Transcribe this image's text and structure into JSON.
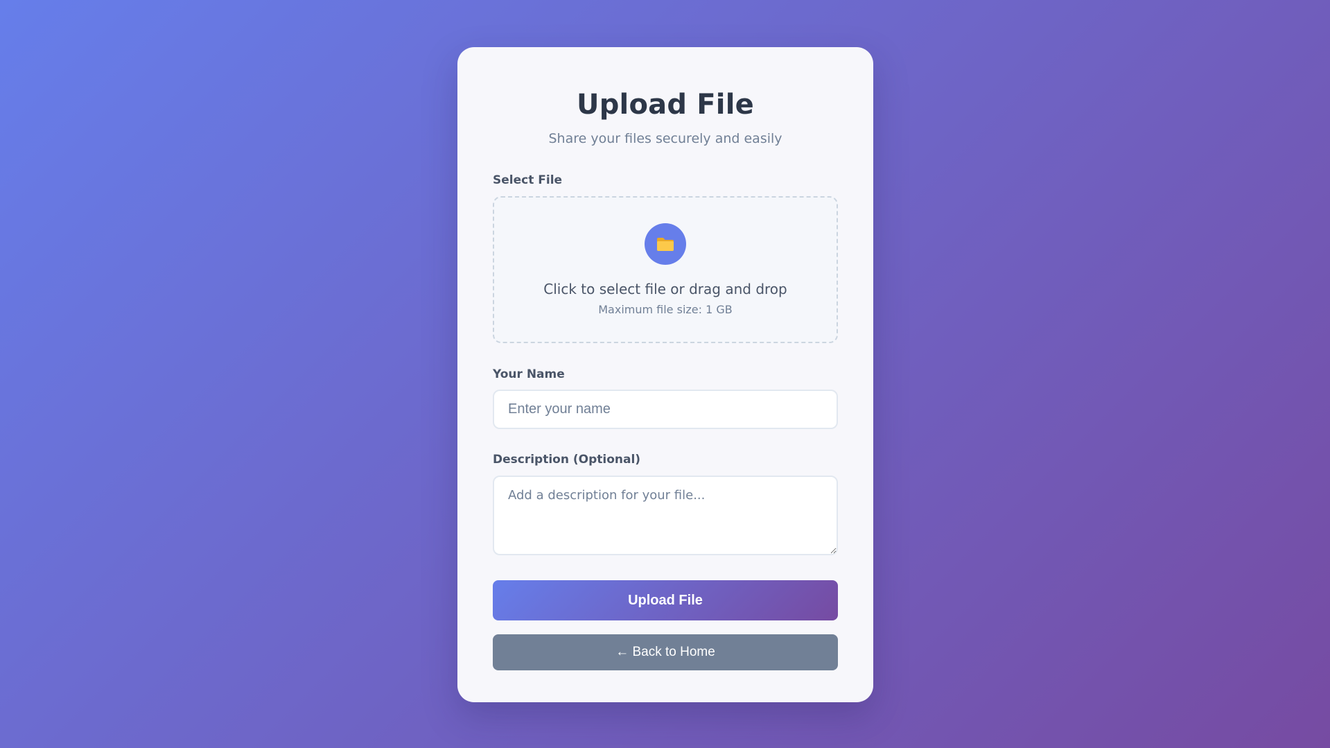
{
  "header": {
    "title": "Upload File",
    "subtitle": "Share your files securely and easily"
  },
  "file_field": {
    "label": "Select File",
    "icon": "folder-icon",
    "prompt": "Click to select file or drag and drop",
    "hint": "Maximum file size: 1 GB"
  },
  "name_field": {
    "label": "Your Name",
    "placeholder": "Enter your name",
    "value": ""
  },
  "description_field": {
    "label": "Description (Optional)",
    "placeholder": "Add a description for your file...",
    "value": ""
  },
  "actions": {
    "upload_label": "Upload File",
    "back_label": "← Back to Home"
  },
  "colors": {
    "accent_start": "#667eea",
    "accent_end": "#764ba2",
    "back_button": "#718096",
    "folder_icon": "#f6c244"
  }
}
